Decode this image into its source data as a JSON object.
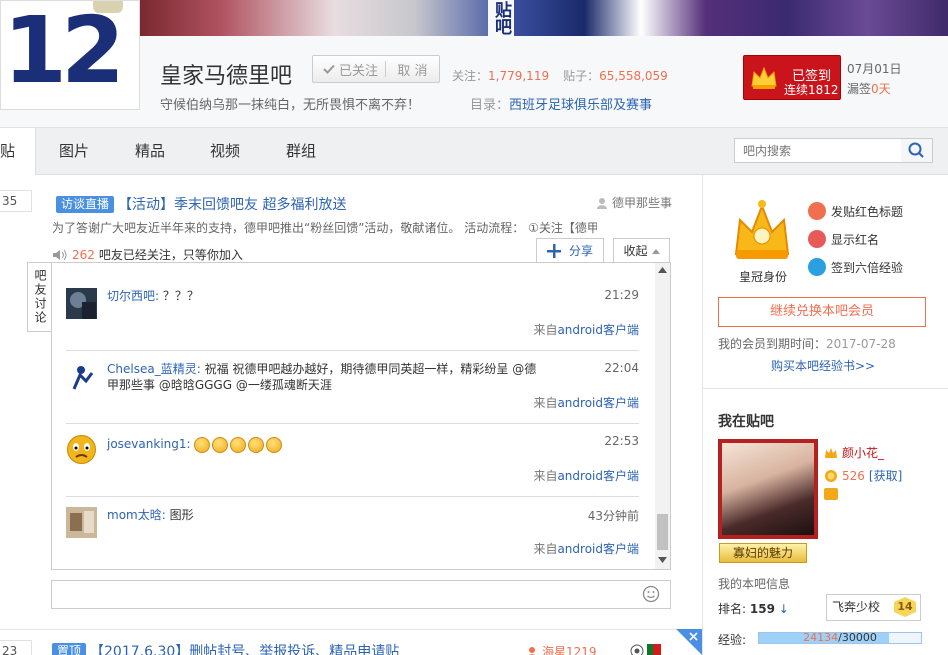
{
  "header": {
    "logo_number": "12",
    "banner_mark": "贴吧",
    "forum_name": "皇家马德里吧",
    "follow_label": "已关注",
    "unfollow_label": "取 消",
    "follow_count_label": "关注：",
    "follow_count": "1,779,119",
    "post_count_label": "贴子：",
    "post_count": "65,558,059",
    "slogan": "守候伯纳乌那一抹纯白，无所畏惧不离不弃！",
    "catalog_label": "目录：",
    "catalog_value": "西班牙足球俱乐部及赛事",
    "sign_status": "已签到",
    "sign_streak": "连续1812",
    "date": "07月01日",
    "missed_label": "漏签",
    "missed_value": "0天"
  },
  "nav": {
    "tabs": [
      {
        "label": "贴"
      },
      {
        "label": "图片"
      },
      {
        "label": "精品"
      },
      {
        "label": "视频"
      },
      {
        "label": "群组"
      }
    ],
    "search_placeholder": "吧内搜索"
  },
  "post1": {
    "reply_count": "35",
    "tag": "访谈直播",
    "title": "【活动】季末回馈吧友 超多福利放送",
    "author": "德甲那些事",
    "abstract": "为了答谢广大吧友近半年来的支持，德甲吧推出“粉丝回馈”活动，敬献诸位。 活动流程： ①关注【德甲",
    "follow_num": "262",
    "follow_text": "吧友已经关注，只等你加入",
    "share_label": "分享",
    "collapse_label": "收起",
    "discussion_tab": "吧友讨论"
  },
  "replies": [
    {
      "user": "切尔西吧:",
      "text": "？？？",
      "time": "21:29",
      "source_prefix": "来自",
      "source": "android客户端"
    },
    {
      "user": "Chelsea_蓝精灵:",
      "text": "祝福 祝德甲吧越办越好，期待德甲同英超一样，精彩纷呈 @德甲那些事 @晗晗GGGG @一缕孤魂断天涯",
      "time": "22:04",
      "source_prefix": "来自",
      "source": "android客户端"
    },
    {
      "user": "josevanking1:",
      "text": "",
      "time": "22:53",
      "source_prefix": "来自",
      "source": "android客户端"
    },
    {
      "user": "mom太晗:",
      "text": "图形",
      "time": "43分钟前",
      "source_prefix": "来自",
      "source": "android客户端"
    }
  ],
  "post2": {
    "reply_count": "23",
    "tag": "置顶",
    "title": "【2017.6.30】删帖封号、举报投诉、精品申请贴",
    "author": "海星1219"
  },
  "sidebar": {
    "crown_caption": "皇冠身份",
    "perks": [
      "发贴红色标题",
      "显示红名",
      "签到六倍经验"
    ],
    "member_button": "继续兑换本吧会员",
    "member_expiry_label": "我的会员到期时间：",
    "member_expiry": "2017-07-28",
    "buy_exp": "购买本吧经验书>>",
    "me_title": "我在贴吧",
    "me_name": "颜小花_",
    "me_badge": "寡妇的魅力",
    "me_coins": "526",
    "me_get": "[获取]",
    "my_info": "我的本吧信息",
    "rank_label": "排名:",
    "rank_value": "159",
    "level_name": "飞奔少校",
    "level_num": "14",
    "exp_label": "经验:",
    "exp_current": "24134",
    "exp_total": "/30000",
    "exp_fraction": 0.8
  },
  "colors": {
    "link": "#2d64b3",
    "accent_orange": "#f06f4f",
    "sign_red": "#c8141a",
    "tag_blue": "#4a90e2"
  }
}
